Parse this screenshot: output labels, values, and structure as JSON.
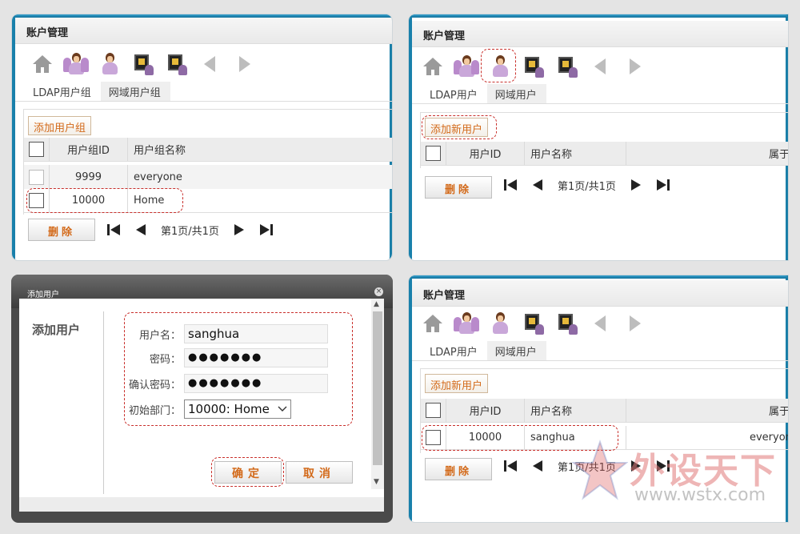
{
  "colors": {
    "accent": "#d36a1a",
    "frame": "#1980ab",
    "highlight": "#c9302c"
  },
  "panel1": {
    "title": "账户管理",
    "toolbar_icons": [
      "home-icon",
      "user-group-icon",
      "user-icon",
      "ldap-group-icon",
      "domain-group-icon",
      "back-arrow-icon",
      "forward-arrow-icon"
    ],
    "tabs": [
      "LDAP用户组",
      "网域用户组"
    ],
    "add_label": "添加用户组",
    "columns": [
      "用户组ID",
      "用户组名称"
    ],
    "rows": [
      {
        "id": "9999",
        "name": "everyone"
      },
      {
        "id": "10000",
        "name": "Home"
      }
    ],
    "delete_label": "删除",
    "page_text": "第1页/共1页"
  },
  "panel2": {
    "title": "账户管理",
    "tabs": [
      "LDAP用户",
      "网域用户"
    ],
    "add_label": "添加新用户",
    "columns": [
      "用户ID",
      "用户名称",
      "属于"
    ],
    "delete_label": "删除",
    "page_text": "第1页/共1页"
  },
  "dialog": {
    "title": "添加用户",
    "heading": "添加用户",
    "username_label": "用户名：",
    "username_value": "sanghua",
    "password_label": "密码：",
    "password_value": "●●●●●●●",
    "confirm_label": "确认密码：",
    "confirm_value": "●●●●●●●",
    "dept_label": "初始部门：",
    "dept_value": "10000: Home",
    "ok_label": "确定",
    "cancel_label": "取消"
  },
  "panel4": {
    "title": "账户管理",
    "tabs": [
      "LDAP用户",
      "网域用户"
    ],
    "add_label": "添加新用户",
    "columns": [
      "用户ID",
      "用户名称",
      "属于"
    ],
    "rows": [
      {
        "id": "10000",
        "name": "sanghua",
        "group": "everyor"
      }
    ],
    "delete_label": "删除",
    "page_text": "第1页/共1页"
  },
  "watermark": {
    "text": "外设天下",
    "url": "www.wstx.com"
  }
}
